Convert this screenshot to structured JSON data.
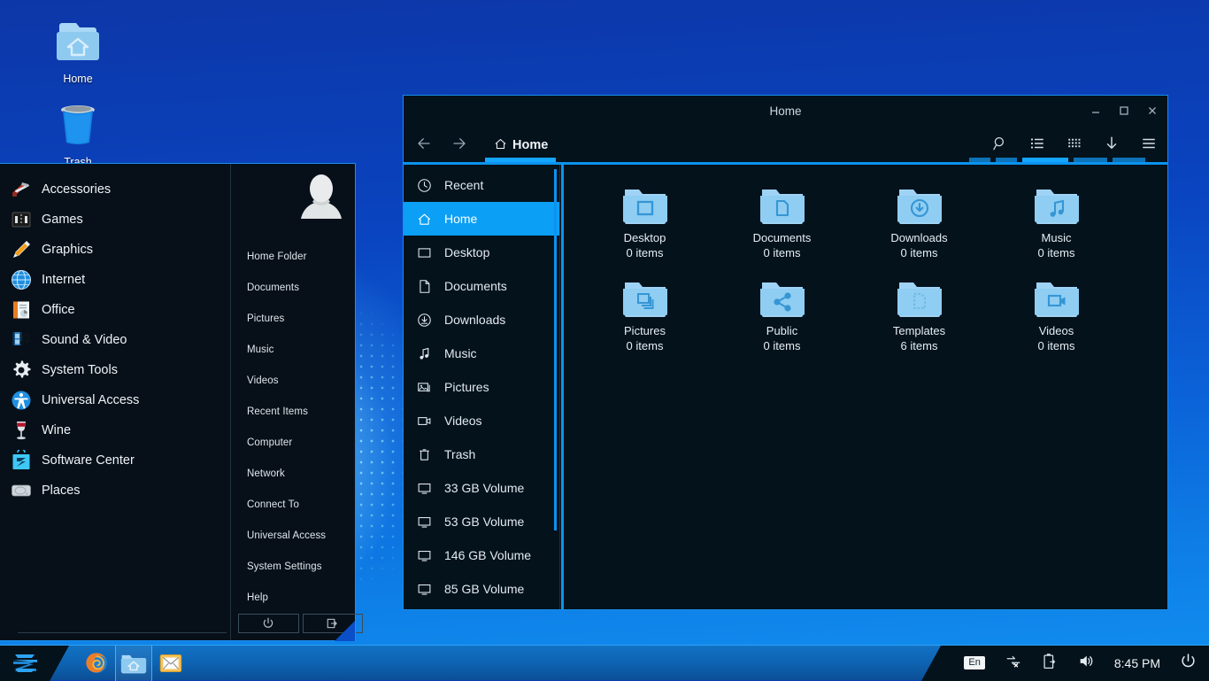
{
  "desktop": {
    "icons": [
      {
        "name": "Home",
        "icon": "home-folder-icon"
      },
      {
        "name": "Trash",
        "icon": "trash-can-icon"
      }
    ]
  },
  "app_menu": {
    "categories": [
      {
        "label": "Accessories",
        "icon": "swiss-knife-icon"
      },
      {
        "label": "Games",
        "icon": "game-controller-icon"
      },
      {
        "label": "Graphics",
        "icon": "paint-brush-icon"
      },
      {
        "label": "Internet",
        "icon": "globe-icon"
      },
      {
        "label": "Office",
        "icon": "document-chart-icon"
      },
      {
        "label": "Sound & Video",
        "icon": "film-music-icon"
      },
      {
        "label": "System Tools",
        "icon": "gear-icon"
      },
      {
        "label": "Universal Access",
        "icon": "accessibility-icon"
      },
      {
        "label": "Wine",
        "icon": "wine-glass-icon"
      },
      {
        "label": "Software Center",
        "icon": "software-center-icon"
      },
      {
        "label": "Places",
        "icon": "hard-disk-icon"
      }
    ],
    "places": [
      "Home Folder",
      "Documents",
      "Pictures",
      "Music",
      "Videos",
      "Recent Items",
      "Computer",
      "Network",
      "Connect To",
      "Universal Access",
      "System Settings",
      "Help"
    ],
    "session": [
      {
        "label": "Shut Down",
        "icon": "power-icon",
        "glyph": "⏻"
      },
      {
        "label": "Log Out",
        "icon": "logout-icon",
        "glyph": "→"
      }
    ]
  },
  "file_manager": {
    "title": "Home",
    "window_controls": [
      {
        "name": "minimize",
        "glyph": "–"
      },
      {
        "name": "maximize",
        "glyph": "□"
      },
      {
        "name": "close",
        "glyph": "✕"
      }
    ],
    "nav": {
      "back": "←",
      "forward": "→"
    },
    "breadcrumb": "Home",
    "tools": [
      {
        "name": "search-icon",
        "title": "Search"
      },
      {
        "name": "list-view-icon",
        "title": "List view"
      },
      {
        "name": "grid-view-icon",
        "title": "Grid view"
      },
      {
        "name": "sort-down-icon",
        "title": "Sort"
      },
      {
        "name": "menu-icon",
        "title": "Menu"
      }
    ],
    "sidebar": [
      {
        "label": "Recent",
        "icon": "clock-icon",
        "active": false
      },
      {
        "label": "Home",
        "icon": "home-icon",
        "active": true
      },
      {
        "label": "Desktop",
        "icon": "desktop-icon",
        "active": false
      },
      {
        "label": "Documents",
        "icon": "document-icon",
        "active": false
      },
      {
        "label": "Downloads",
        "icon": "download-icon",
        "active": false
      },
      {
        "label": "Music",
        "icon": "music-note-icon",
        "active": false
      },
      {
        "label": "Pictures",
        "icon": "pictures-icon",
        "active": false
      },
      {
        "label": "Videos",
        "icon": "video-camera-icon",
        "active": false
      },
      {
        "label": "Trash",
        "icon": "trash-icon",
        "active": false
      },
      {
        "label": "33 GB Volume",
        "icon": "drive-icon",
        "active": false
      },
      {
        "label": "53 GB Volume",
        "icon": "drive-icon",
        "active": false
      },
      {
        "label": "146 GB Volume",
        "icon": "drive-icon",
        "active": false
      },
      {
        "label": "85 GB Volume",
        "icon": "drive-icon",
        "active": false
      }
    ],
    "files": [
      {
        "name": "Desktop",
        "items": "0 items",
        "icon": "folder-desktop-icon"
      },
      {
        "name": "Documents",
        "items": "0 items",
        "icon": "folder-documents-icon"
      },
      {
        "name": "Downloads",
        "items": "0 items",
        "icon": "folder-downloads-icon"
      },
      {
        "name": "Music",
        "items": "0 items",
        "icon": "folder-music-icon"
      },
      {
        "name": "Pictures",
        "items": "0 items",
        "icon": "folder-pictures-icon"
      },
      {
        "name": "Public",
        "items": "0 items",
        "icon": "folder-public-icon"
      },
      {
        "name": "Templates",
        "items": "6 items",
        "icon": "folder-templates-icon"
      },
      {
        "name": "Videos",
        "items": "0 items",
        "icon": "folder-videos-icon"
      }
    ]
  },
  "taskbar": {
    "start": {
      "label": "Start",
      "icon": "zorin-logo-icon"
    },
    "launchers": [
      {
        "name": "firefox-icon",
        "label": "Firefox"
      },
      {
        "name": "file-manager-icon",
        "label": "Files"
      },
      {
        "name": "mail-icon",
        "label": "Mail"
      }
    ],
    "tray": {
      "language": "En",
      "network_icon": "network-disconnected-icon",
      "device_icon": "removable-device-icon",
      "volume_icon": "volume-icon",
      "clock": "8:45 PM",
      "power_icon": "power-icon"
    }
  },
  "colors": {
    "accent": "#0b93ef",
    "accent_bright": "#15a6ff",
    "window_bg": "#04121c",
    "desktop_blue": "#0a44c0",
    "folder_blue": "#8fcdf2"
  }
}
